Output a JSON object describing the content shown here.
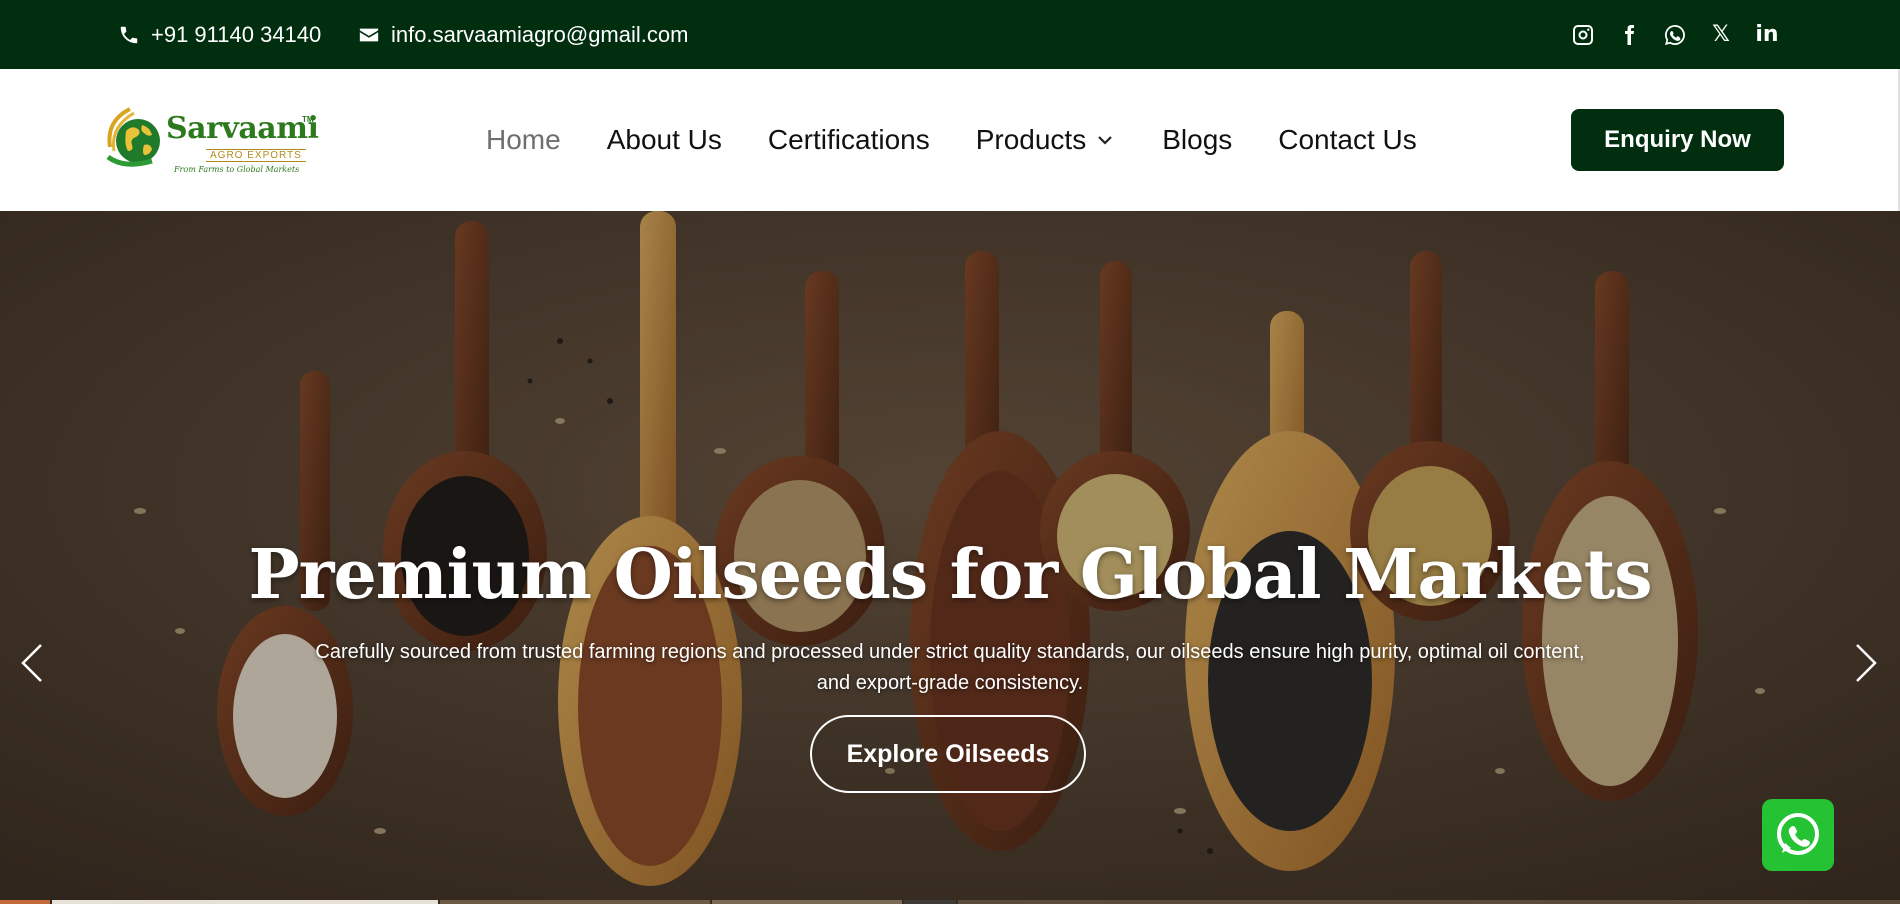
{
  "topbar": {
    "phone": "+91 91140 34140",
    "email": "info.sarvaamiagro@gmail.com",
    "socials": [
      {
        "name": "instagram-icon"
      },
      {
        "name": "facebook-icon"
      },
      {
        "name": "whatsapp-icon"
      },
      {
        "name": "x-icon",
        "glyph": "𝕏"
      },
      {
        "name": "linkedin-icon",
        "glyph": "in"
      }
    ]
  },
  "logo": {
    "brand": "Sarvaami",
    "tm": "TM",
    "sub": "AGRO EXPORTS",
    "tagline": "From Farms to Global Markets"
  },
  "nav": {
    "items": [
      {
        "label": "Home",
        "active": true
      },
      {
        "label": "About Us"
      },
      {
        "label": "Certifications"
      },
      {
        "label": "Products",
        "has_dropdown": true
      },
      {
        "label": "Blogs"
      },
      {
        "label": "Contact Us"
      }
    ],
    "cta": "Enquiry Now"
  },
  "hero": {
    "title": "Premium Oilseeds for Global Markets",
    "description": "Carefully sourced from trusted farming regions and processed under strict quality standards, our oilseeds ensure high purity, optimal oil content, and export-grade consistency.",
    "button": "Explore Oilseeds"
  },
  "colors": {
    "brand_dark_green": "#002e0e",
    "whatsapp_green": "#25c233",
    "nav_active": "#6f6f6f"
  }
}
